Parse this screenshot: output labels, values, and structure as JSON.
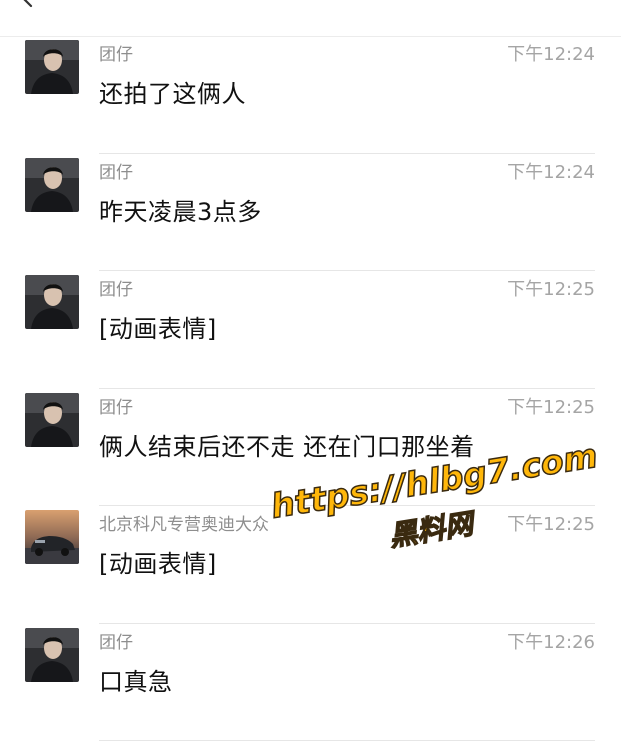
{
  "header": {
    "back_icon": "chevron-left-icon",
    "right_text": ""
  },
  "messages": [
    {
      "sender": "团仔",
      "time": "下午12:24",
      "text": "还拍了这俩人",
      "avatar": "person-avatar"
    },
    {
      "sender": "团仔",
      "time": "下午12:24",
      "text": "昨天凌晨3点多",
      "avatar": "person-avatar"
    },
    {
      "sender": "团仔",
      "time": "下午12:25",
      "text": "[动画表情]",
      "avatar": "person-avatar"
    },
    {
      "sender": "团仔",
      "time": "下午12:25",
      "text": "俩人结束后还不走 还在门口那坐着",
      "avatar": "person-avatar"
    },
    {
      "sender": "北京科凡专营奥迪大众",
      "time": "下午12:25",
      "text": "[动画表情]",
      "avatar": "car-avatar"
    },
    {
      "sender": "团仔",
      "time": "下午12:26",
      "text": "口真急",
      "avatar": "person-avatar"
    }
  ],
  "watermark": {
    "url": "https://hlbg7.com",
    "name": "黑料网"
  }
}
